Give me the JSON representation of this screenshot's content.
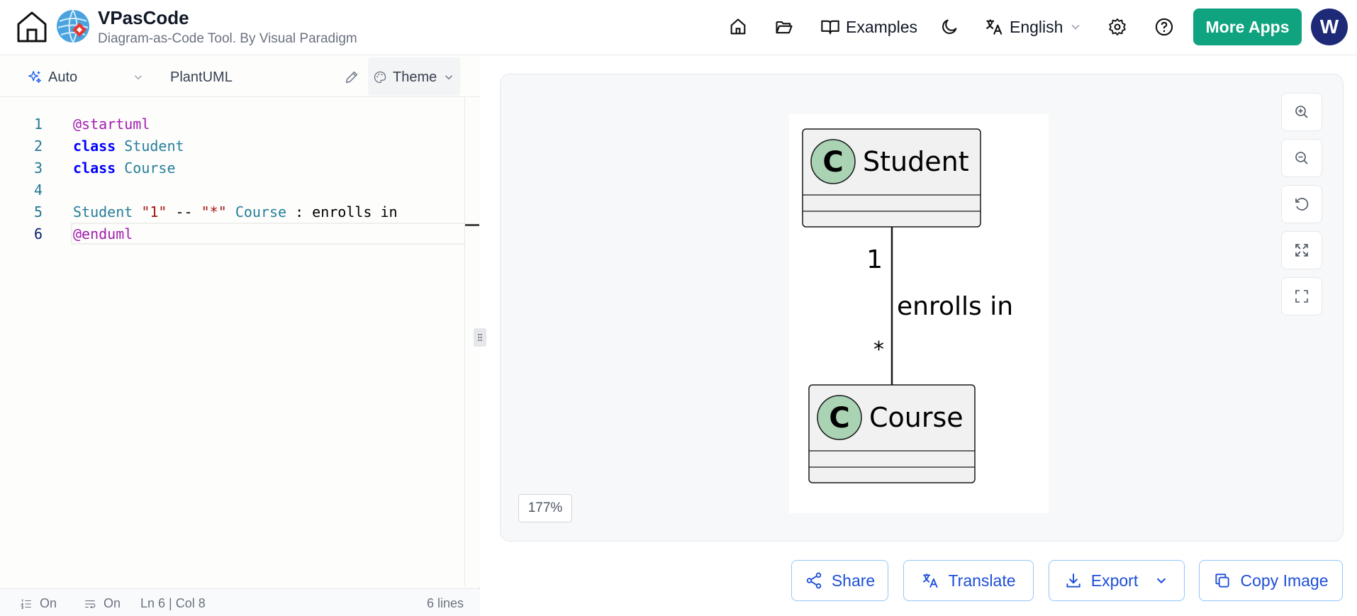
{
  "header": {
    "title": "VPasCode",
    "subtitle": "Diagram-as-Code Tool. By Visual Paradigm",
    "nav": {
      "examples_label": "Examples",
      "language_label": "English"
    },
    "more_apps_label": "More Apps",
    "avatar_letter": "W"
  },
  "editor": {
    "mode_label": "Auto",
    "language_label": "PlantUML",
    "theme_label": "Theme",
    "lines": [
      {
        "num": "1",
        "tokens": [
          {
            "t": "@startuml",
            "c": "at"
          }
        ]
      },
      {
        "num": "2",
        "tokens": [
          {
            "t": "class",
            "c": "class"
          },
          {
            "t": " Student",
            "c": "type"
          }
        ]
      },
      {
        "num": "3",
        "tokens": [
          {
            "t": "class",
            "c": "class"
          },
          {
            "t": " Course",
            "c": "type"
          }
        ]
      },
      {
        "num": "4",
        "tokens": []
      },
      {
        "num": "5",
        "tokens": [
          {
            "t": "Student",
            "c": "type"
          },
          {
            "t": " ",
            "c": "plain"
          },
          {
            "t": "\"1\"",
            "c": "str"
          },
          {
            "t": " -- ",
            "c": "plain"
          },
          {
            "t": "\"*\"",
            "c": "str"
          },
          {
            "t": " ",
            "c": "plain"
          },
          {
            "t": "Course",
            "c": "type"
          },
          {
            "t": " : enrolls in",
            "c": "plain"
          }
        ]
      },
      {
        "num": "6",
        "tokens": [
          {
            "t": "@enduml",
            "c": "at"
          }
        ]
      }
    ],
    "status": {
      "line_numbers_toggle": "On",
      "wrap_toggle": "On",
      "cursor_position": "Ln 6 | Col 8",
      "line_count": "6 lines"
    }
  },
  "preview": {
    "zoom_level": "177%",
    "diagram": {
      "class_top": "Student",
      "class_bottom": "Course",
      "class_badge": "C",
      "multiplicity_top": "1",
      "multiplicity_bottom": "*",
      "association_label": "enrolls in"
    }
  },
  "actions": {
    "share_label": "Share",
    "translate_label": "Translate",
    "export_label": "Export",
    "copy_image_label": "Copy Image"
  },
  "colors": {
    "accent": "#10a37f",
    "avatar": "#1e2a78",
    "action_text": "#1d4ed8",
    "class_badge": "#a9d3b3",
    "class_fill": "#f1f1f1"
  }
}
